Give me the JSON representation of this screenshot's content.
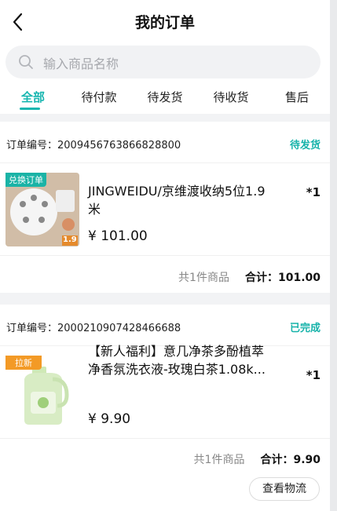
{
  "header": {
    "title": "我的订单",
    "back_icon": "chevron-left-icon"
  },
  "search": {
    "placeholder": "输入商品名称",
    "icon": "search-icon"
  },
  "tabs": [
    {
      "label": "全部",
      "active": true
    },
    {
      "label": "待付款",
      "active": false
    },
    {
      "label": "待发货",
      "active": false
    },
    {
      "label": "待收货",
      "active": false
    },
    {
      "label": "售后",
      "active": false
    }
  ],
  "accent_color": "#18b6b0",
  "orders": [
    {
      "order_no": "订单编号：2009456763866828800",
      "status": "待发货",
      "product_name": "JINGWEIDU/京维渡收纳5位1.9米",
      "price": "¥ 101.00",
      "qty": "*1",
      "item_count": "共1件商品",
      "total": "合计：101.00",
      "badge": "兑换订单",
      "thumb_text": "1.9"
    },
    {
      "order_no": "订单编号：2000210907428466688",
      "status": "已完成",
      "product_name": "【新人福利】意几净茶多酚植萃净香氛洗衣液-玫瑰白茶1.08k...",
      "price": "¥ 9.90",
      "qty": "*1",
      "item_count": "共1件商品",
      "total": "合计：9.90",
      "badge": "拉新",
      "action_label": "查看物流"
    }
  ]
}
